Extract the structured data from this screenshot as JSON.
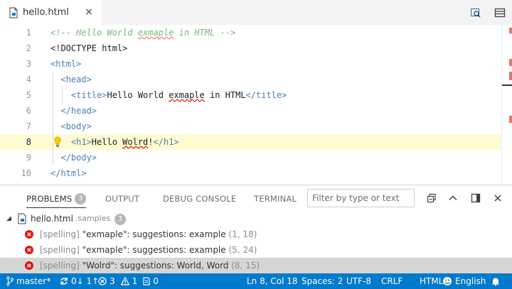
{
  "tab": {
    "label": "hello.html",
    "close": "×"
  },
  "editor": {
    "lines": [
      {
        "n": "1",
        "parts": [
          {
            "t": "<!-- Hello World ",
            "c": "c-com"
          },
          {
            "t": "exmaple",
            "c": "c-com squig"
          },
          {
            "t": " in HTML -->",
            "c": "c-com"
          }
        ]
      },
      {
        "n": "2",
        "parts": [
          {
            "t": "<!DOCTYPE html>",
            "c": "c-txt"
          }
        ]
      },
      {
        "n": "3",
        "parts": [
          {
            "t": "<html>",
            "c": "c-tag"
          }
        ]
      },
      {
        "n": "4",
        "parts": [
          {
            "t": "  <head>",
            "c": "c-tag"
          }
        ]
      },
      {
        "n": "5",
        "parts": [
          {
            "t": "    <title>",
            "c": "c-tag"
          },
          {
            "t": "Hello World ",
            "c": "c-txt"
          },
          {
            "t": "exmaple",
            "c": "c-txt squig"
          },
          {
            "t": " in HTML",
            "c": "c-txt"
          },
          {
            "t": "</title>",
            "c": "c-tag"
          }
        ]
      },
      {
        "n": "6",
        "parts": [
          {
            "t": "  </head>",
            "c": "c-tag"
          }
        ]
      },
      {
        "n": "7",
        "parts": [
          {
            "t": "  <body>",
            "c": "c-tag"
          }
        ]
      },
      {
        "n": "8",
        "parts": [
          {
            "t": "    <h1>",
            "c": "c-tag"
          },
          {
            "t": "Hello ",
            "c": "c-txt"
          },
          {
            "t": "Wolrd",
            "c": "c-txt squig"
          },
          {
            "t": "!",
            "c": "c-txt"
          },
          {
            "t": "</h1>",
            "c": "c-tag"
          }
        ]
      },
      {
        "n": "9",
        "parts": [
          {
            "t": "  </body>",
            "c": "c-tag"
          }
        ]
      },
      {
        "n": "10",
        "parts": [
          {
            "t": "</html>",
            "c": "c-tag"
          }
        ]
      }
    ]
  },
  "panel": {
    "tabs": {
      "problems": "PROBLEMS",
      "problems_count": "3",
      "output": "OUTPUT",
      "debug": "DEBUG CONSOLE",
      "terminal": "TERMINAL"
    },
    "filter_placeholder": "Filter by type or text",
    "file": {
      "name": "hello.html",
      "folder": ".samples",
      "count": "3"
    },
    "problems": [
      {
        "source": "[spelling]",
        "msg": "\"exmaple\": suggestions: example",
        "loc": "(1, 18)"
      },
      {
        "source": "[spelling]",
        "msg": "\"exmaple\": suggestions: example",
        "loc": "(5, 24)"
      },
      {
        "source": "[spelling]",
        "msg": "\"Wolrd\": suggestions: World, Word",
        "loc": "(8, 15)"
      }
    ]
  },
  "status": {
    "branch": "master*",
    "sync": "0↓ 1↑",
    "errors": "3",
    "warnings": "1",
    "info": "0",
    "position": "Ln 8, Col 18",
    "spaces": "Spaces: 2",
    "encoding": "UTF-8",
    "eol": "CRLF",
    "language": "HTML",
    "locale": "English"
  },
  "colors": {
    "accent": "#007acc",
    "error": "#e51400",
    "current_line": "#fffbd1"
  },
  "icons": [
    "file-html-icon",
    "close-icon",
    "open-preview-icon",
    "split-editor-icon",
    "lightbulb-icon",
    "error-icon",
    "maximize-panel-icon",
    "chevron-up-icon",
    "toggle-layout-icon",
    "git-branch-icon",
    "sync-icon",
    "warning-icon",
    "bell-icon",
    "smiley-icon"
  ]
}
